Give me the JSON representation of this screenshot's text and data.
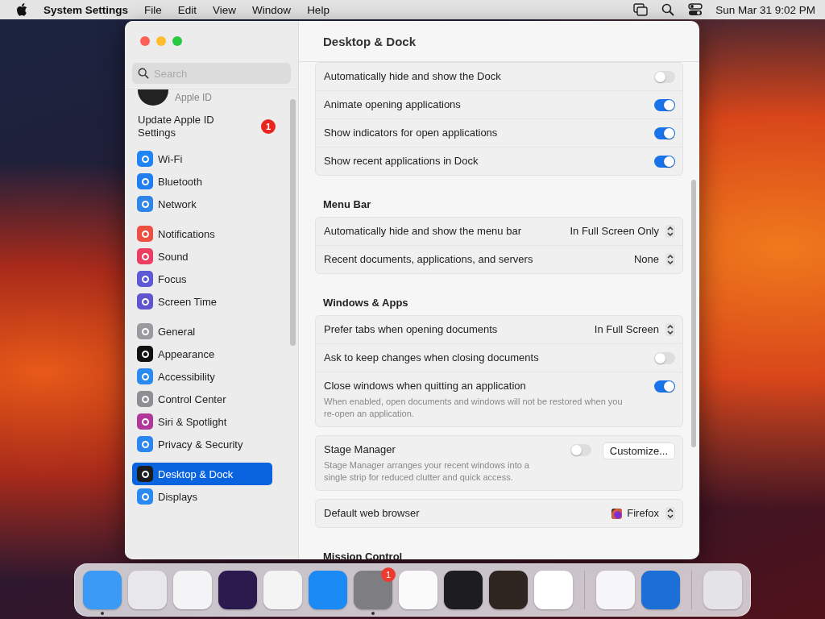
{
  "menu_bar": {
    "app_name": "System Settings",
    "menus": [
      "File",
      "Edit",
      "View",
      "Window",
      "Help"
    ],
    "clock": "Sun Mar 31  9:02 PM"
  },
  "window": {
    "title": "Desktop & Dock"
  },
  "sidebar": {
    "search": {
      "placeholder": "Search"
    },
    "account": {
      "label": "Apple ID"
    },
    "update": {
      "label": "Update Apple ID Settings",
      "badge": "1"
    },
    "groups": [
      [
        {
          "label": "Wi-Fi",
          "color": "#1f84f5",
          "selected": false
        },
        {
          "label": "Bluetooth",
          "color": "#1f7ef0",
          "selected": false
        },
        {
          "label": "Network",
          "color": "#2f86e8",
          "selected": false
        }
      ],
      [
        {
          "label": "Notifications",
          "color": "#ee4f43",
          "selected": false
        },
        {
          "label": "Sound",
          "color": "#ec3d62",
          "selected": false
        },
        {
          "label": "Focus",
          "color": "#5e5ad6",
          "selected": false
        },
        {
          "label": "Screen Time",
          "color": "#5f55cf",
          "selected": false
        }
      ],
      [
        {
          "label": "General",
          "color": "#9a9a9e",
          "selected": false
        },
        {
          "label": "Appearance",
          "color": "#111111",
          "selected": false
        },
        {
          "label": "Accessibility",
          "color": "#2a8af0",
          "selected": false
        },
        {
          "label": "Control Center",
          "color": "#8e8e93",
          "selected": false
        },
        {
          "label": "Siri & Spotlight",
          "color": "#b0389a",
          "selected": false
        },
        {
          "label": "Privacy & Security",
          "color": "#2c86f0",
          "selected": false
        }
      ],
      [
        {
          "label": "Desktop & Dock",
          "color": "#1b1b1d",
          "selected": true
        },
        {
          "label": "Displays",
          "color": "#2b8af2",
          "selected": false
        }
      ]
    ]
  },
  "sections": [
    {
      "rows": [
        {
          "kind": "toggle",
          "label": "Automatically hide and show the Dock",
          "on": false
        },
        {
          "kind": "toggle",
          "label": "Animate opening applications",
          "on": true
        },
        {
          "kind": "toggle",
          "label": "Show indicators for open applications",
          "on": true
        },
        {
          "kind": "toggle",
          "label": "Show recent applications in Dock",
          "on": true
        }
      ]
    },
    {
      "heading": "Menu Bar",
      "rows": [
        {
          "kind": "select",
          "label": "Automatically hide and show the menu bar",
          "value": "In Full Screen Only"
        },
        {
          "kind": "select",
          "label": "Recent documents, applications, and servers",
          "value": "None"
        }
      ]
    },
    {
      "heading": "Windows & Apps",
      "rows": [
        {
          "kind": "select",
          "label": "Prefer tabs when opening documents",
          "value": "In Full Screen"
        },
        {
          "kind": "toggle",
          "label": "Ask to keep changes when closing documents",
          "on": false
        },
        {
          "kind": "toggle",
          "label": "Close windows when quitting an application",
          "on": true,
          "description": "When enabled, open documents and windows will not be restored when you re-open an application."
        }
      ]
    },
    {
      "rows": [
        {
          "kind": "toggle_button",
          "label": "Stage Manager",
          "on": false,
          "button": "Customize...",
          "description": "Stage Manager arranges your recent windows into a single strip for reduced clutter and quick access."
        }
      ]
    },
    {
      "rows": [
        {
          "kind": "browser",
          "label": "Default web browser",
          "value": "Firefox"
        }
      ]
    },
    {
      "heading": "Mission Control"
    }
  ],
  "dock": {
    "groups": [
      [
        {
          "color": "#3b9af5",
          "running": true
        },
        {
          "color": "#e8e8ec",
          "running": false
        },
        {
          "color": "#f4f4f6",
          "running": false
        },
        {
          "color": "#2a1a4e",
          "running": false
        },
        {
          "color": "#f4f4f4",
          "running": false
        },
        {
          "color": "#1c8af5",
          "running": false
        },
        {
          "color": "#7d7d82",
          "running": true,
          "badge": "1"
        },
        {
          "color": "#fafafa",
          "running": false
        },
        {
          "color": "#1d1d1f",
          "running": false
        },
        {
          "color": "#2e2420",
          "running": false
        },
        {
          "color": "#ffffff",
          "running": false
        }
      ],
      [
        {
          "color": "#f6f6f8",
          "running": false
        },
        {
          "color": "#1b6fd6",
          "running": false
        }
      ],
      [
        {
          "color": "#e4e4e6",
          "running": false
        }
      ]
    ]
  }
}
